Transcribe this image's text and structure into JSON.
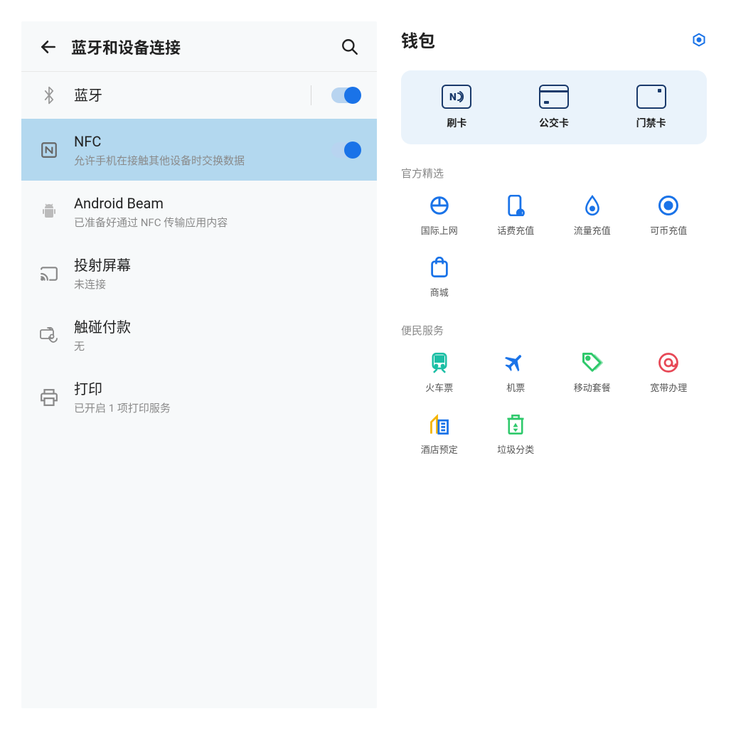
{
  "left": {
    "title": "蓝牙和设备连接",
    "items": [
      {
        "title": "蓝牙",
        "sub": "",
        "toggle": true,
        "selected": false
      },
      {
        "title": "NFC",
        "sub": "允许手机在接触其他设备时交换数据",
        "toggle": true,
        "selected": true
      },
      {
        "title": "Android Beam",
        "sub": "已准备好通过 NFC 传输应用内容",
        "toggle": false,
        "selected": false
      },
      {
        "title": "投射屏幕",
        "sub": "未连接",
        "toggle": false,
        "selected": false
      },
      {
        "title": "触碰付款",
        "sub": "无",
        "toggle": false,
        "selected": false
      },
      {
        "title": "打印",
        "sub": "已开启 1 项打印服务",
        "toggle": false,
        "selected": false
      }
    ]
  },
  "right": {
    "title": "钱包",
    "cards": [
      {
        "label": "刷卡"
      },
      {
        "label": "公交卡"
      },
      {
        "label": "门禁卡"
      }
    ],
    "section1_title": "官方精选",
    "section1_items": [
      {
        "label": "国际上网"
      },
      {
        "label": "话费充值"
      },
      {
        "label": "流量充值"
      },
      {
        "label": "可币充值"
      },
      {
        "label": "商城"
      }
    ],
    "section2_title": "便民服务",
    "section2_items": [
      {
        "label": "火车票"
      },
      {
        "label": "机票"
      },
      {
        "label": "移动套餐"
      },
      {
        "label": "宽带办理"
      },
      {
        "label": "酒店预定"
      },
      {
        "label": "垃圾分类"
      }
    ]
  }
}
